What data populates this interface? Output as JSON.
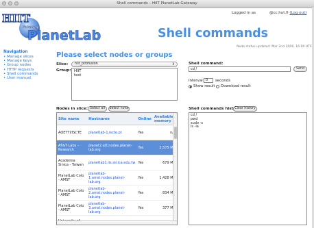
{
  "window": {
    "title": "Shell commands – HIIT PlanetLab Gateway"
  },
  "header": {
    "logo_hiit": "HIIT",
    "logo_gateway": "Gateway",
    "logo_planetlab": "PlanetLab",
    "page_title": "Shell commands",
    "logged_in_label": "Logged in as",
    "user": "@cc.hut.fi",
    "logout": "(Log out)",
    "status_line": "Node status updated: Mar 2nd 2006, 16:00 UTC"
  },
  "nav": {
    "title": "Navigation",
    "items": [
      {
        "label": "Manage slices"
      },
      {
        "label": "Manage keys"
      },
      {
        "label": "Group nodes"
      },
      {
        "label": "HTTP requests"
      },
      {
        "label": "Shell commands"
      },
      {
        "label": "User manual"
      }
    ]
  },
  "main": {
    "heading": "Please select nodes or groups",
    "slice_label": "Slice:",
    "slice_value": "hiit_pitofusion",
    "group_label": "Group:",
    "groups": [
      "HIIT",
      "test"
    ],
    "nodes_label": "Nodes in slice:",
    "select_all": "Select all",
    "select_none": "Select none",
    "table": {
      "headers": [
        "Site name",
        "Hostname",
        "Online",
        "Available memory"
      ],
      "rows": [
        {
          "site": "AOETTI/ISCTE",
          "host": "planetlab-1.iscte.pt",
          "online": "Yes",
          "mem": "n/a",
          "selected": false
        },
        {
          "site": "AT&T Labs – Research",
          "host": "planet2.att.nodes.planet-lab.org",
          "online": "Yes",
          "mem": "2,575 MB",
          "selected": true
        },
        {
          "site": "Academia Sinica - Taiwan",
          "host": "planetlab1.iis.sinica.edu.tw",
          "online": "Yes",
          "mem": "679 MB",
          "selected": false
        },
        {
          "site": "PlanetLab Colo - AMST",
          "host": "planetlab-1.amst.nodes.planet-lab.org",
          "online": "Yes",
          "mem": "1,428 MB",
          "selected": false
        },
        {
          "site": "PlanetLab Colo - AMST",
          "host": "planetlab-2.amst.nodes.planet-lab.org",
          "online": "Yes",
          "mem": "834 MB",
          "selected": false
        },
        {
          "site": "PlanetLab Colo - AMST",
          "host": "planetlab-3.amst.nodes.planet-lab.org",
          "online": "Yes",
          "mem": "377 MB",
          "selected": false
        },
        {
          "site": "University of Michigan",
          "host": "planetlab1.eecs.umich.edu",
          "online": "Yes",
          "mem": "1,721 MB",
          "selected": false
        }
      ]
    }
  },
  "right": {
    "cmd_label": "Shell command:",
    "cmd_value": "cd /",
    "send": "Send",
    "interval_label": "Interval:",
    "interval_value": "0",
    "seconds": "seconds",
    "show_result": "Show result",
    "download_result": "Download result",
    "history_label": "Shell commands history:",
    "clear_history": "Clear history",
    "history": [
      "cd /",
      "pwd",
      "sudo -s",
      "ls -la"
    ]
  },
  "colors": {
    "accent": "#4a90e2",
    "selected_row": "#5c8fd8",
    "link": "#2255cc"
  }
}
